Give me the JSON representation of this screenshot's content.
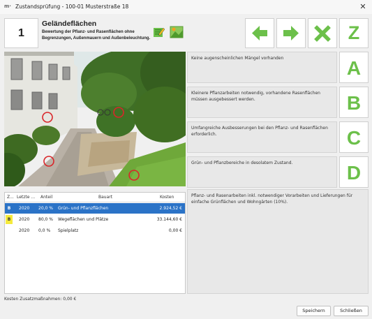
{
  "window": {
    "app_icon_text": "m·",
    "title": "Zustandsprüfung - 100-01 Musterstraße 18",
    "close_glyph": "✕"
  },
  "category": {
    "number": "1",
    "title": "Geländeflächen",
    "description": "Bewertung der Pflanz- und Rasenflächen ohne Begrenzungen, Außenmauern und Außenbeleuchtung."
  },
  "nav": {
    "z_label": "Z"
  },
  "options": [
    {
      "letter": "A",
      "text": "Keine augenscheinlichen Mängel vorhanden"
    },
    {
      "letter": "B",
      "text": "Kleinere Pflanzarbeiten notwendig, vorhandene Rasenflächen müssen ausgebessert werden."
    },
    {
      "letter": "C",
      "text": "Umfangreiche Ausbesserungen bei den Pflanz- und Rasenflächen erforderlich."
    },
    {
      "letter": "D",
      "text": "Grün- und Pflanzbereiche in desolatem Zustand."
    }
  ],
  "table": {
    "headers": {
      "z": "Z...",
      "letzte": "Letzte ...",
      "anteil": "Anteil",
      "bauart": "Bauart",
      "kosten": "Kosten"
    },
    "rows": [
      {
        "z": "B",
        "letzte": "2020",
        "anteil": "20,0 %",
        "bauart": "Grün- und Pflanzflächen",
        "kosten": "2.924,52 €"
      },
      {
        "z": "B",
        "letzte": "2020",
        "anteil": "80,0 %",
        "bauart": "Wegeflächen und Plätze",
        "kosten": "33.144,60 €"
      },
      {
        "z": "",
        "letzte": "2020",
        "anteil": "0,0 %",
        "bauart": "Spielplatz",
        "kosten": "0,00 €"
      }
    ]
  },
  "info_text": "Pflanz- und Rasenarbeiten inkl. notwendiger Vorarbeiten und Lieferungen für einfache Grünflächen und Wohngärten (10%).",
  "extra_cost": "Kosten Zusatzmaßnahmen: 0,00 €",
  "buttons": {
    "save": "Speichern",
    "close": "Schließen"
  },
  "colors": {
    "accent_green": "#6cc04a",
    "selection_blue": "#2b73c7",
    "badge_yellow": "#f5ea3c",
    "marker_red": "#d9262a"
  }
}
